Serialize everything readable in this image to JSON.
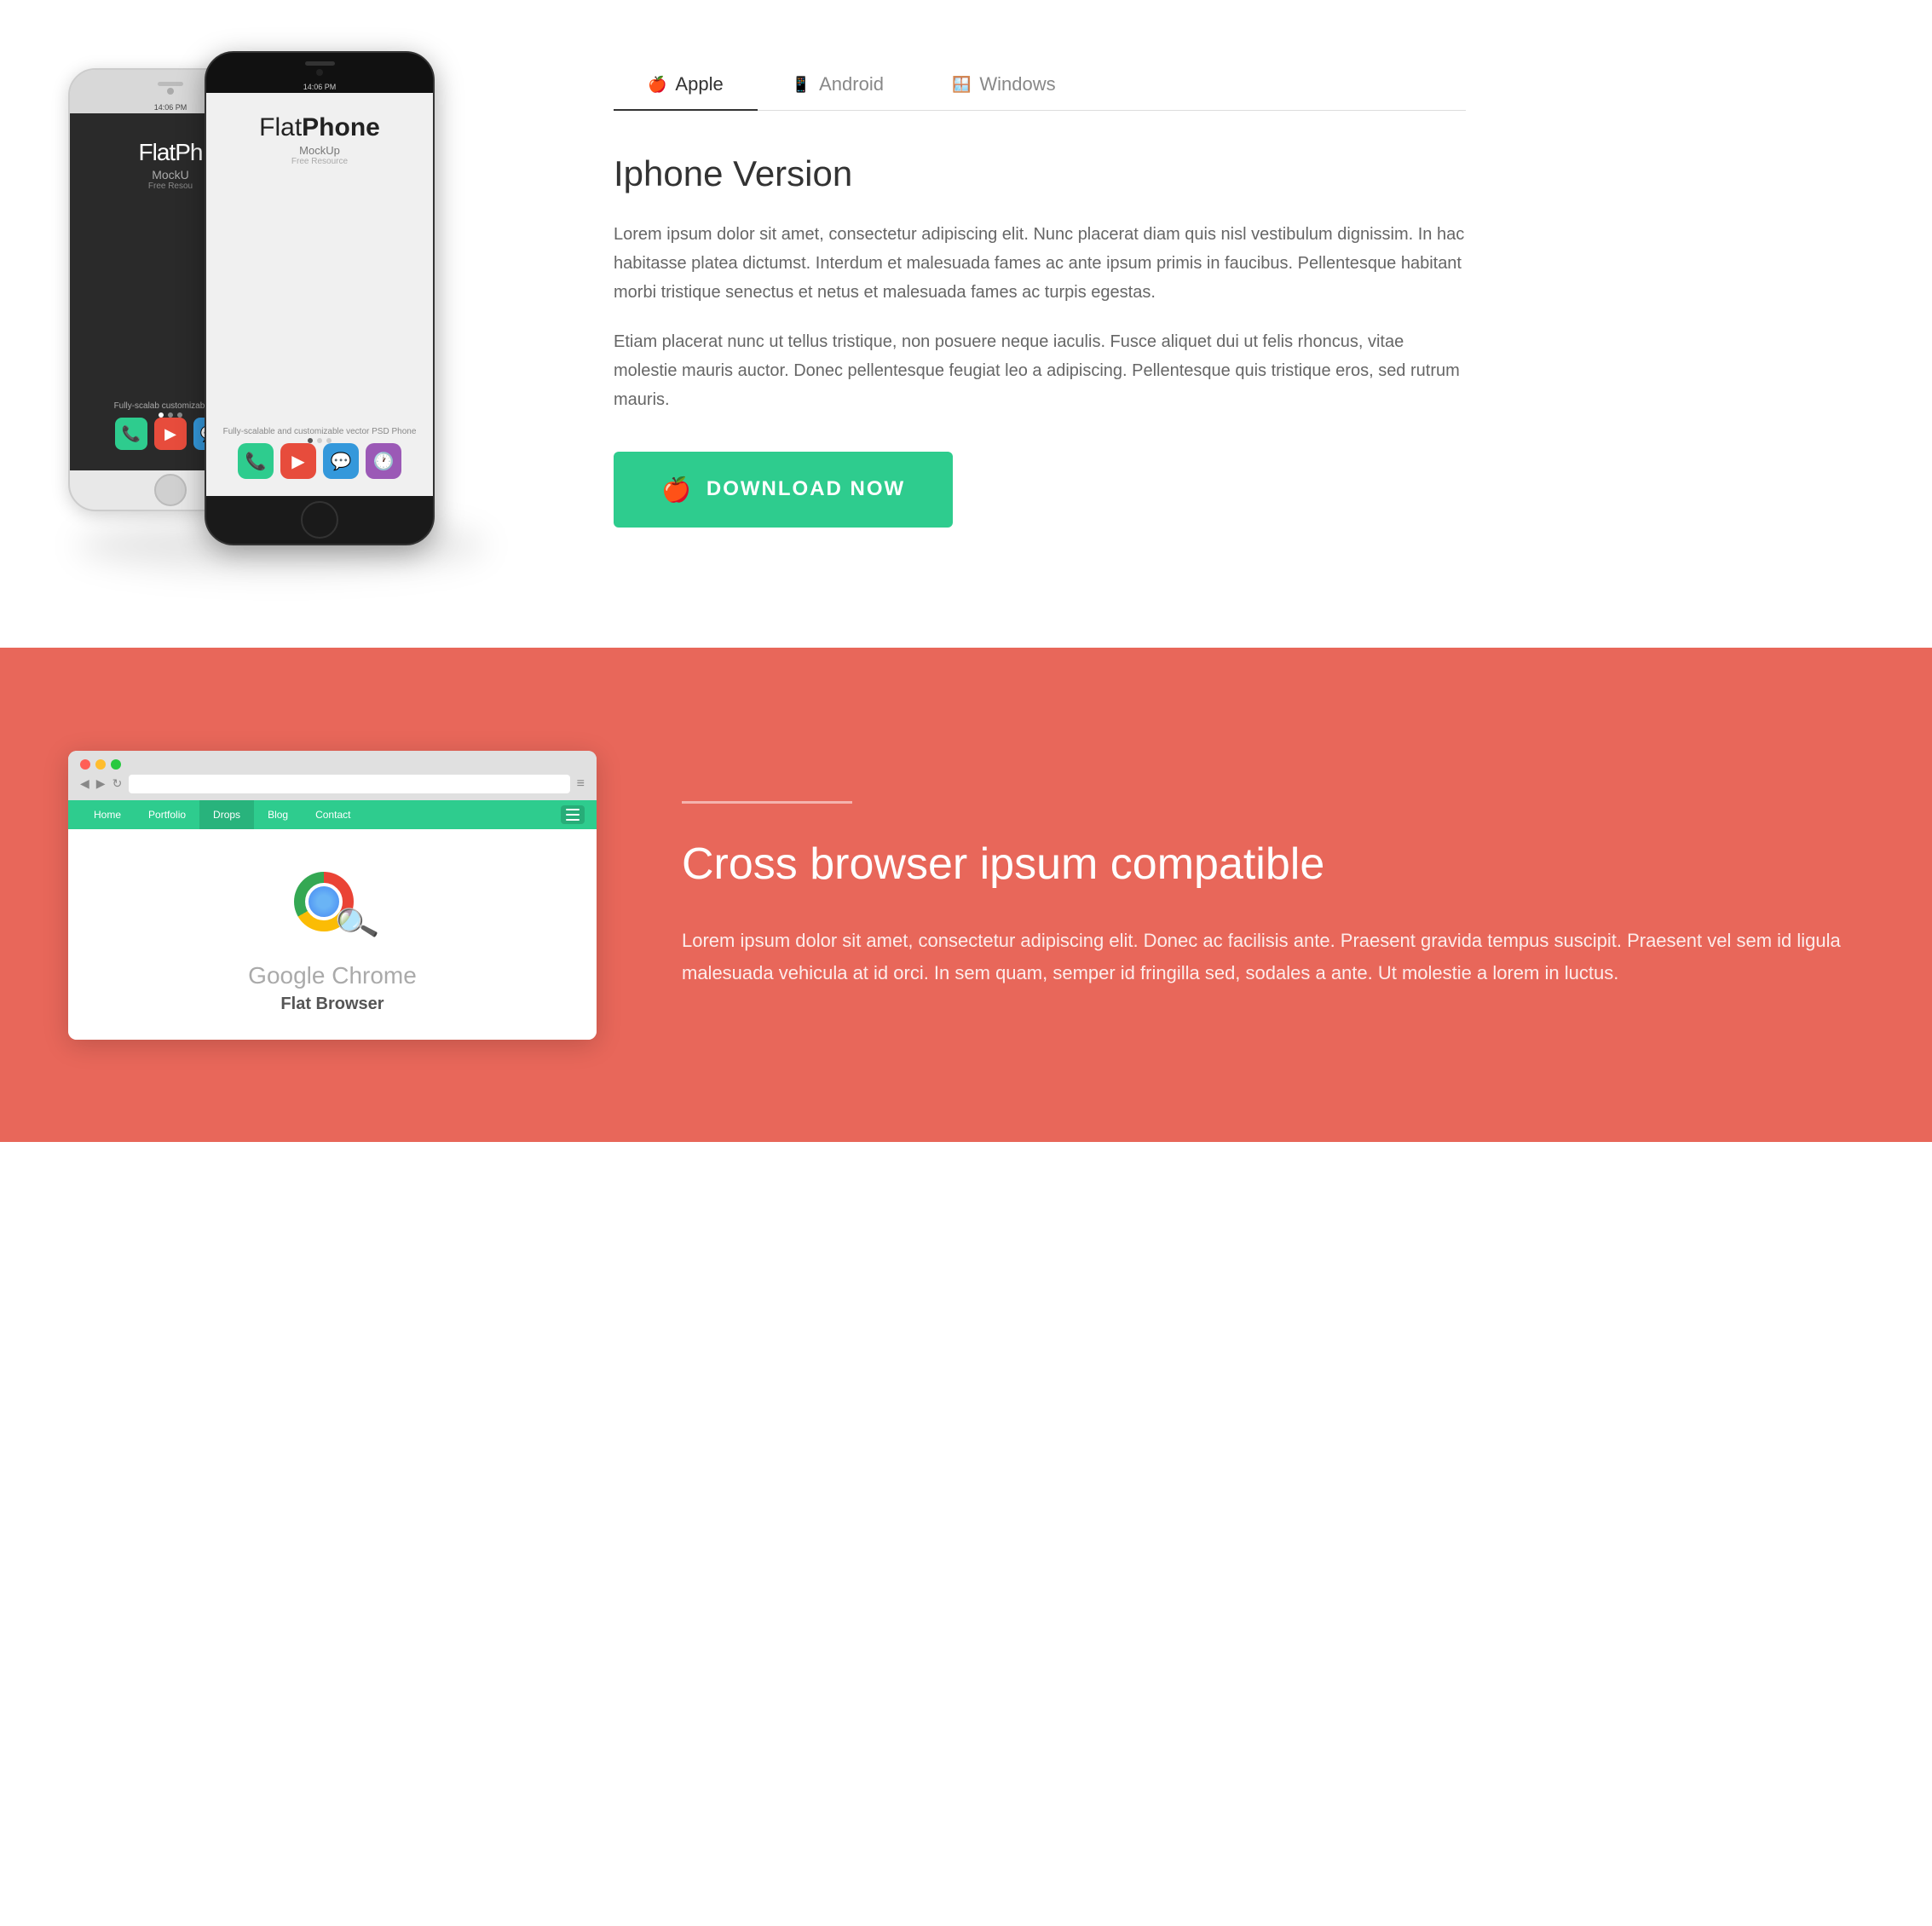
{
  "section_top": {
    "phone_white": {
      "time": "14:06 PM",
      "app_flat": "FlatPh",
      "app_phone": "",
      "mockup": "MockU",
      "free": "Free Resou",
      "description": "Fully-scalab\ncustomizable vec"
    },
    "phone_black": {
      "time": "14:06 PM",
      "app_flat": "Flat",
      "app_phone": "Phone",
      "mockup": "MockUp",
      "free": "Free Resource",
      "description": "Fully-scalable and\ncustomizable vector PSD Phone"
    },
    "tabs": [
      {
        "id": "apple",
        "label": "Apple",
        "icon": "🍎",
        "active": true
      },
      {
        "id": "android",
        "label": "Android",
        "icon": "📱",
        "active": false
      },
      {
        "id": "windows",
        "label": "Windows",
        "icon": "🪟",
        "active": false
      }
    ],
    "content_title": "Iphone Version",
    "content_para1": "Lorem ipsum dolor sit amet, consectetur adipiscing elit. Nunc placerat diam quis nisl vestibulum dignissim. In hac habitasse platea dictumst. Interdum et malesuada fames ac ante ipsum primis in faucibus. Pellentesque habitant morbi tristique senectus et netus et malesuada fames ac turpis egestas.",
    "content_para2": "Etiam placerat nunc ut tellus tristique, non posuere neque iaculis. Fusce aliquet dui ut felis rhoncus, vitae molestie mauris auctor. Donec pellentesque feugiat leo a adipiscing. Pellentesque quis tristique eros, sed rutrum mauris.",
    "download_label": "DOWNLOAD NOW"
  },
  "section_bottom": {
    "bg_color": "#e8675a",
    "browser": {
      "dots": [
        "red",
        "yellow",
        "green"
      ],
      "nav_items": [
        "Home",
        "Portfolio",
        "Drops",
        "Blog",
        "Contact"
      ],
      "active_nav": "Drops",
      "logo_alt": "Google Chrome search icon",
      "google_chrome": "Google Chrome",
      "flat_browser": "Flat Browser"
    },
    "heading": "Cross browser ipsum compatible",
    "paragraph": "Lorem ipsum dolor sit amet, consectetur adipiscing elit. Donec ac facilisis ante. Praesent gravida tempus suscipit. Praesent vel sem id ligula malesuada vehicula at id orci. In sem quam, semper id fringilla sed, sodales a ante. Ut molestie a lorem in luctus.",
    "divider": "—"
  }
}
